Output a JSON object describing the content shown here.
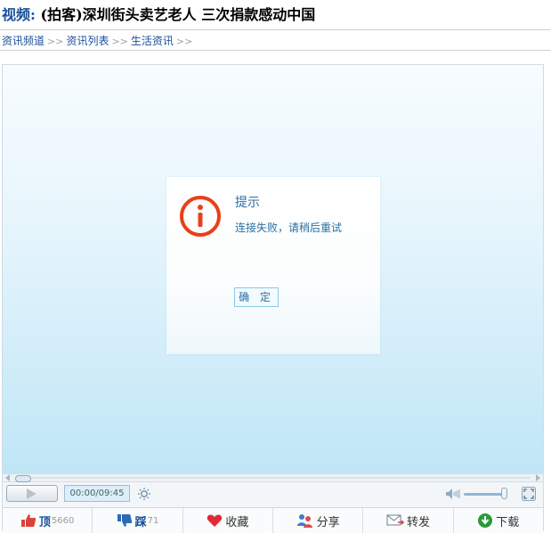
{
  "title": {
    "prefix": "视频:",
    "text": " (拍客)深圳街头卖艺老人 三次捐款感动中国"
  },
  "breadcrumb": {
    "items": [
      "资讯频道",
      "资讯列表",
      "生活资讯"
    ],
    "separator": ">>"
  },
  "dialog": {
    "title": "提示",
    "message": "连接失败，请稍后重试",
    "ok_label": "确 定"
  },
  "player": {
    "time": "00:00/09:45"
  },
  "actions": {
    "up_label": "顶",
    "up_count": "5660",
    "down_label": "踩",
    "down_count": "71",
    "fav_label": "收藏",
    "share_label": "分享",
    "forward_label": "转发",
    "download_label": "下载"
  },
  "colors": {
    "accent": "#1a4f9b",
    "alert": "#e8401a",
    "dialog_text": "#2a6fa3"
  }
}
